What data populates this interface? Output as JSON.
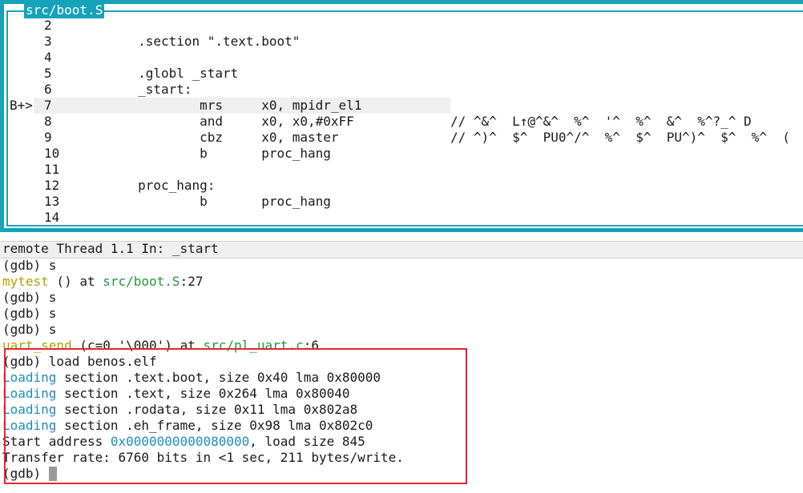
{
  "source_window": {
    "title": "src/boot.S",
    "lines": [
      {
        "num": "2",
        "code": ""
      },
      {
        "num": "3",
        "code": "        .section \".text.boot\""
      },
      {
        "num": "4",
        "code": ""
      },
      {
        "num": "5",
        "code": "        .globl _start"
      },
      {
        "num": "6",
        "code": "        _start:"
      },
      {
        "num": "7",
        "code": "                mrs     x0, mpidr_el1"
      },
      {
        "num": "8",
        "code": "                and     x0, x0,#0xFF"
      },
      {
        "num": "9",
        "code": "                cbz     x0, master"
      },
      {
        "num": "10",
        "code": "                b       proc_hang"
      },
      {
        "num": "11",
        "code": ""
      },
      {
        "num": "12",
        "code": "        proc_hang:"
      },
      {
        "num": "13",
        "code": "                b       proc_hang"
      },
      {
        "num": "14",
        "code": ""
      }
    ],
    "breakpoint_marker": "B+>",
    "garbage_line_8": "// ^&^  L↑@^&^  %^  '^  %^  &^  %^?_^ D",
    "garbage_line_9": "// ^)^  $^  PU0^/^  %^  $^  PU^)^  $^  %^  ("
  },
  "status_bar": {
    "text": "remote Thread 1.1 In: _start"
  },
  "console": {
    "lines": [
      {
        "type": "plain",
        "text": "(gdb) s"
      },
      {
        "type": "fn",
        "fn": "mytest",
        "mid": " () at ",
        "path": "src/boot.S",
        "tail": ":27"
      },
      {
        "type": "plain",
        "text": "(gdb) s"
      },
      {
        "type": "plain",
        "text": "(gdb) s"
      },
      {
        "type": "plain",
        "text": "(gdb) s"
      },
      {
        "type": "fn",
        "fn": "uart_send",
        "mid": " (c=0 '\\000') at ",
        "path": "src/pl_uart.c",
        "tail": ":6"
      },
      {
        "type": "plain",
        "text": "(gdb) load benos.elf"
      },
      {
        "type": "load",
        "head": "Loading",
        "text": " section .text.boot, size 0x40 lma 0x80000"
      },
      {
        "type": "load",
        "head": "Loading",
        "text": " section .text, size 0x264 lma 0x80040"
      },
      {
        "type": "load",
        "head": "Loading",
        "text": " section .rodata, size 0x11 lma 0x802a8"
      },
      {
        "type": "load",
        "head": "Loading",
        "text": " section .eh_frame, size 0x98 lma 0x802c0"
      },
      {
        "type": "addr",
        "head": "Start address ",
        "addr": "0x0000000000080000",
        "tail": ", load size 845"
      },
      {
        "type": "plain",
        "text": "Transfer rate: 6760 bits in <1 sec, 211 bytes/write."
      },
      {
        "type": "plain",
        "text": "(gdb) "
      }
    ]
  },
  "colors": {
    "tui_frame": "#16a2ba",
    "function_name": "#b5a000",
    "file_path": "#1f9b3a",
    "loading_keyword": "#1f8ec0",
    "highlight_box": "#e0282f"
  }
}
